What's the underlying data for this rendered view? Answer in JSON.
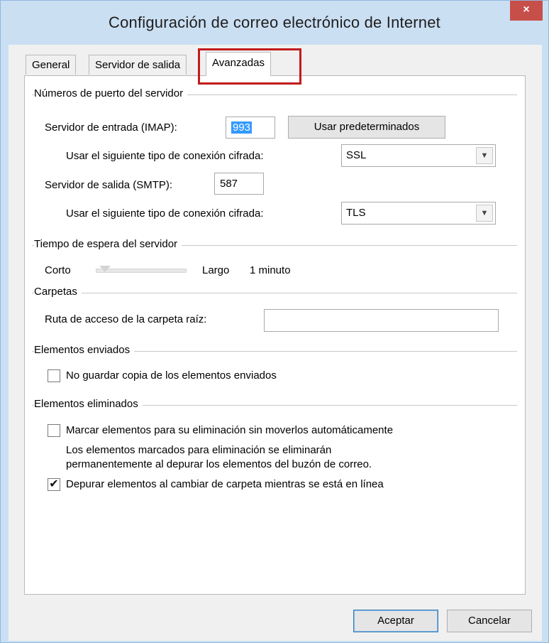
{
  "window": {
    "title": "Configuración de correo electrónico de Internet",
    "close_label": "×"
  },
  "tabs": [
    {
      "label": "General"
    },
    {
      "label": "Servidor de salida"
    },
    {
      "label": "Avanzadas"
    }
  ],
  "ports": {
    "section": "Números de puerto del servidor",
    "incoming_label": "Servidor de entrada (IMAP):",
    "incoming_value": "993",
    "defaults_button": "Usar predeterminados",
    "enc_label_1": "Usar el siguiente tipo de conexión cifrada:",
    "enc_value_1": "SSL",
    "outgoing_label": "Servidor de salida (SMTP):",
    "outgoing_value": "587",
    "enc_label_2": "Usar el siguiente tipo de conexión cifrada:",
    "enc_value_2": "TLS"
  },
  "timeout": {
    "section": "Tiempo de espera del servidor",
    "short": "Corto",
    "long": "Largo",
    "value": "1 minuto",
    "slider_level": 0.1
  },
  "folders": {
    "section": "Carpetas",
    "root_label": "Ruta de acceso de la carpeta raíz:",
    "root_value": ""
  },
  "sent": {
    "section": "Elementos enviados",
    "no_copy_label": "No guardar copia de los elementos enviados",
    "no_copy_checked": false
  },
  "deleted": {
    "section": "Elementos eliminados",
    "mark_label": "Marcar elementos para su eliminación sin moverlos automáticamente",
    "mark_checked": false,
    "info_line1": "Los elementos marcados para eliminación se eliminarán",
    "info_line2": "permanentemente al depurar los elementos del buzón de correo.",
    "purge_label": "Depurar elementos al cambiar de carpeta mientras se está en línea",
    "purge_checked": true,
    "check_glyph": "✔"
  },
  "buttons": {
    "ok": "Aceptar",
    "cancel": "Cancelar"
  }
}
